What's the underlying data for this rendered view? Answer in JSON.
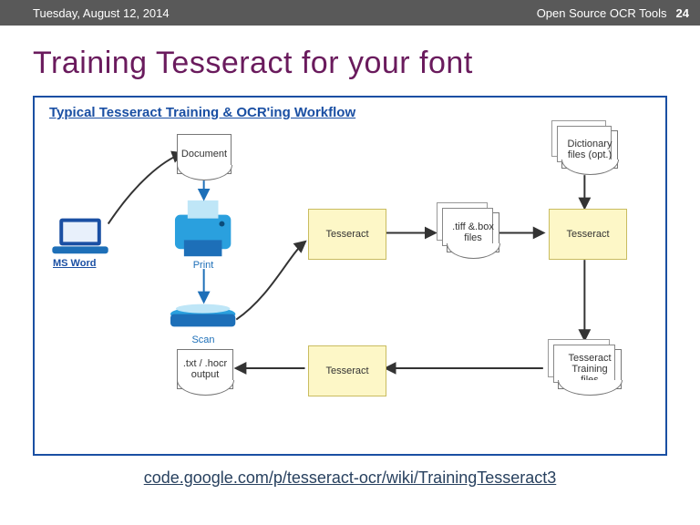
{
  "header": {
    "date": "Tuesday, August 12, 2014",
    "deck": "Open Source OCR Tools",
    "page": "24"
  },
  "title": "Training Tesseract for your font",
  "diagram": {
    "title": "Typical Tesseract Training & OCR'ing Workflow",
    "msword": "MS Word",
    "document": "Document",
    "print": "Print",
    "scan": "Scan",
    "tesseract1": "Tesseract",
    "tiffbox": ".tiff &.box files",
    "dictionary": "Dictionary files (opt.)",
    "tesseract2": "Tesseract",
    "training_files": "Tesseract Training files",
    "tesseract3": "Tesseract",
    "output": ".txt / .hocr output"
  },
  "link": {
    "text": "code.google.com/p/tesseract-ocr/wiki/TrainingTesseract3"
  }
}
